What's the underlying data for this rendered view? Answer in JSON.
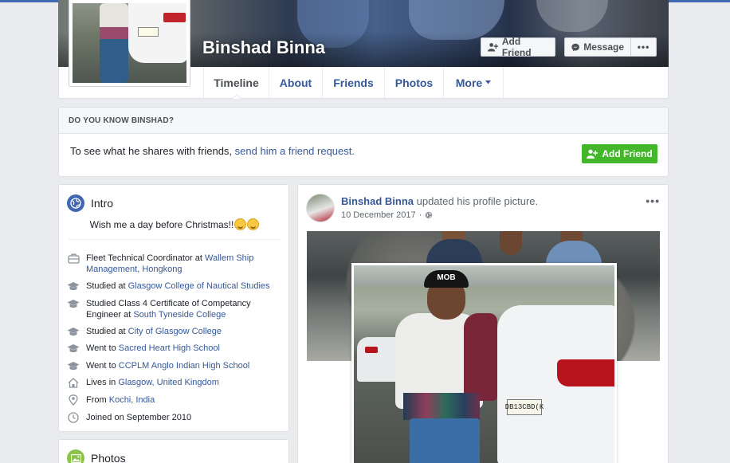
{
  "profile": {
    "name": "Binshad Binna",
    "add_friend_label": "Add Friend",
    "message_label": "Message",
    "more_label": "•••"
  },
  "nav": {
    "tabs": [
      {
        "label": "Timeline"
      },
      {
        "label": "About"
      },
      {
        "label": "Friends"
      },
      {
        "label": "Photos"
      },
      {
        "label": "More"
      }
    ]
  },
  "know_box": {
    "heading": "DO YOU KNOW BINSHAD?",
    "text": "To see what he shares with friends, ",
    "link": "send him a friend request.",
    "button": "Add Friend"
  },
  "intro": {
    "title": "Intro",
    "bio": "Wish me a day before Christmas!!",
    "facts": [
      {
        "icon": "briefcase-icon",
        "text": "Fleet Technical Coordinator at ",
        "link": "Wallem Ship Management, Hongkong"
      },
      {
        "icon": "graduation-cap-icon",
        "text": "Studied at ",
        "link": "Glasgow College of Nautical Studies"
      },
      {
        "icon": "graduation-cap-icon",
        "text": "Studied Class 4 Certificate of Competancy Engineer at ",
        "link": "South Tyneside College"
      },
      {
        "icon": "graduation-cap-icon",
        "text": "Studied at ",
        "link": "City of Glasgow College"
      },
      {
        "icon": "graduation-cap-icon",
        "text": "Went to ",
        "link": "Sacred Heart High School"
      },
      {
        "icon": "graduation-cap-icon",
        "text": "Went to ",
        "link": "CCPLM Anglo Indian High School"
      },
      {
        "icon": "home-icon",
        "text": "Lives in ",
        "link": "Glasgow, United Kingdom"
      },
      {
        "icon": "location-pin-icon",
        "text": "From ",
        "link": "Kochi, India"
      },
      {
        "icon": "clock-icon",
        "text": "Joined on September 2010",
        "link": ""
      }
    ]
  },
  "photos_card": {
    "title": "Photos"
  },
  "post": {
    "author": "Binshad Binna",
    "action": " updated his profile picture.",
    "date": "10 December 2017",
    "separator": "·",
    "dots": "•••",
    "cap_text": "MOB",
    "plate_text": "DB13CBD(K"
  }
}
